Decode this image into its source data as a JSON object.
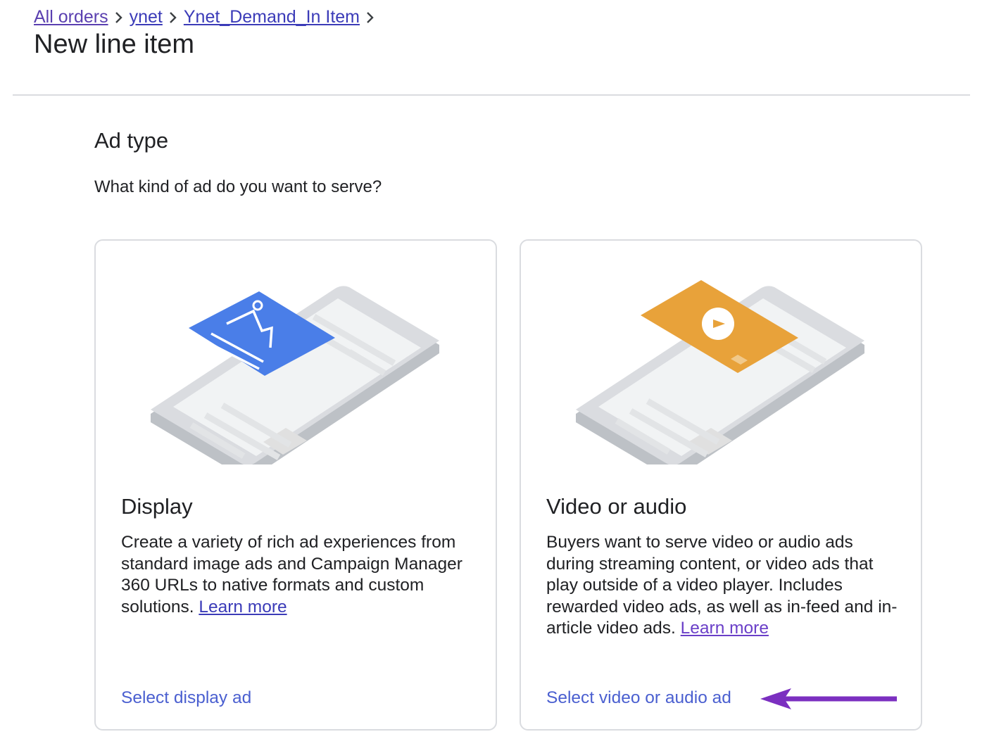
{
  "breadcrumb": {
    "items": [
      {
        "label": "All orders"
      },
      {
        "label": "ynet"
      },
      {
        "label": "Ynet_Demand_In Item"
      }
    ]
  },
  "page": {
    "title": "New line item"
  },
  "ad_type": {
    "title": "Ad type",
    "question": "What kind of ad do you want to serve?",
    "cards": {
      "display": {
        "title": "Display",
        "description": "Create a variety of rich ad experiences from standard image ads and Campaign Manager 360 URLs to native formats and custom solutions.",
        "learn_more": "Learn more",
        "action": "Select display ad",
        "illustration": "display-ad-phone-illustration",
        "accent_color": "#4a7ee8"
      },
      "video": {
        "title": "Video or audio",
        "description": "Buyers want to serve video or audio ads during streaming content, or video ads that play outside of a video player. Includes rewarded video ads, as well as in-feed and in-article video ads.",
        "learn_more": "Learn more",
        "action": "Select video or audio ad",
        "illustration": "video-ad-phone-illustration",
        "accent_color": "#e8a23a"
      }
    }
  },
  "annotation": {
    "icon": "arrow-left-icon",
    "color": "#7b2fc0"
  },
  "colors": {
    "link": "#3b3bb8",
    "action": "#4a5fd0",
    "divider": "#dadce0"
  }
}
